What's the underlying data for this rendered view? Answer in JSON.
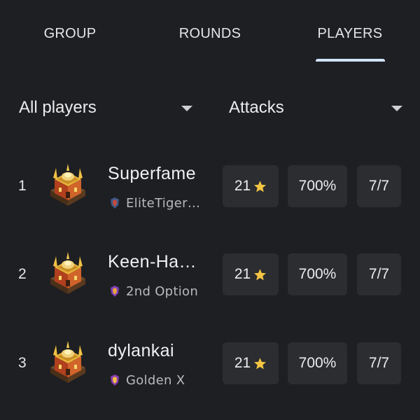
{
  "tabs": [
    {
      "label": "GROUP",
      "active": false
    },
    {
      "label": "ROUNDS",
      "active": false
    },
    {
      "label": "PLAYERS",
      "active": true
    }
  ],
  "filters": {
    "players_selected": "All players",
    "stat_selected": "Attacks"
  },
  "players": [
    {
      "rank": "1",
      "name": "Superfame",
      "clan": "EliteTiger…",
      "stars": "21",
      "percent": "700%",
      "attacks": "7/7",
      "avatar_icon": "town-hall-icon",
      "clan_badge_icon": "clan-badge-icon"
    },
    {
      "rank": "2",
      "name": "Keen-Ha…",
      "clan": "2nd Option",
      "stars": "21",
      "percent": "700%",
      "attacks": "7/7",
      "avatar_icon": "town-hall-icon",
      "clan_badge_icon": "clan-badge-icon"
    },
    {
      "rank": "3",
      "name": "dylankai",
      "clan": "Golden X",
      "stars": "21",
      "percent": "700%",
      "attacks": "7/7",
      "avatar_icon": "town-hall-icon",
      "clan_badge_icon": "clan-badge-icon"
    }
  ],
  "colors": {
    "background": "#1e1f22",
    "card": "#2b2d31",
    "tab_indicator": "#cfe3ff",
    "star": "#f4c542"
  }
}
